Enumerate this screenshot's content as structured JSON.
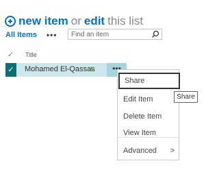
{
  "header": {
    "new_item": "new item",
    "or": "or",
    "edit": "edit",
    "this_list": "this list",
    "icon": "plus-circle-icon"
  },
  "toolbar": {
    "view_label": "All Items",
    "more_label": "•••",
    "search_placeholder": "Find an item"
  },
  "list": {
    "select_all_mark": "✓",
    "column_title": "Title",
    "rows": [
      {
        "check": "✓",
        "title": "Mohamed El-Qassas",
        "new_badge": "✳",
        "more": "•••"
      }
    ]
  },
  "context_menu": {
    "items": [
      "Share",
      "Edit Item",
      "Delete Item",
      "View Item",
      "Advanced"
    ],
    "submenu_chevron": ">"
  },
  "tooltip": {
    "text": "Share"
  },
  "colors": {
    "accent": "#0072c6",
    "row_selected": "#cce6eb",
    "check_bg": "#0c6f74"
  }
}
